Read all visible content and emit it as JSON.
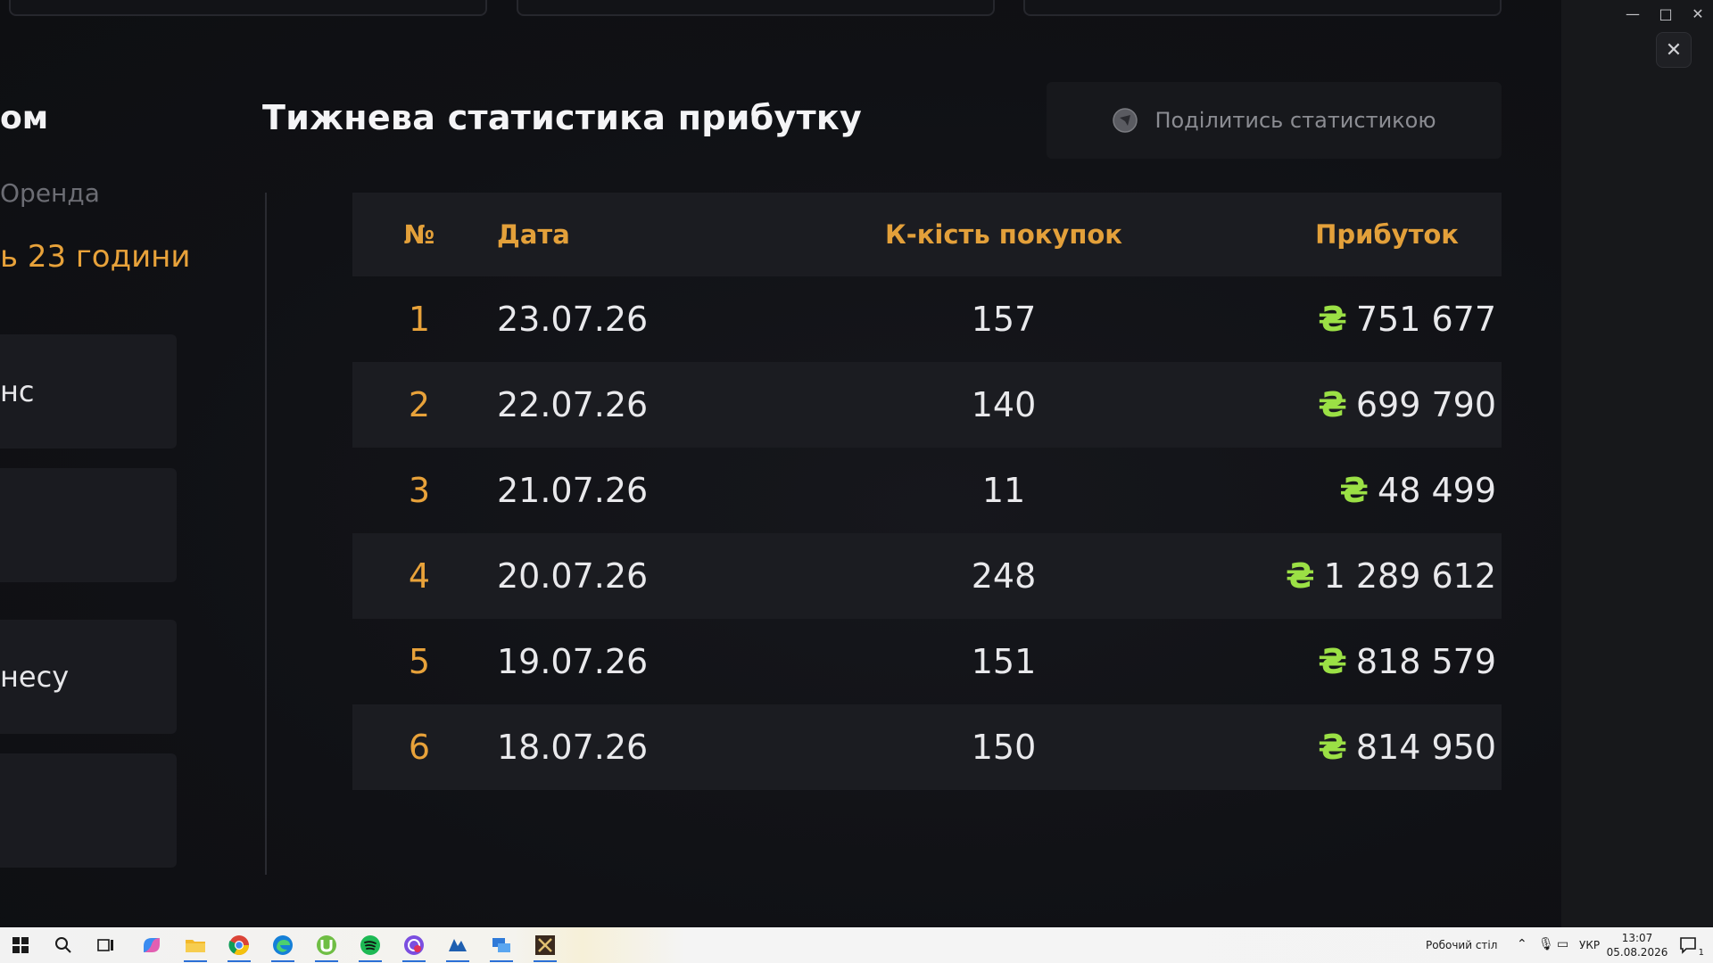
{
  "left_panel": {
    "heading": "ом",
    "sub": "Оренда",
    "time": "ь 23 години",
    "cards": [
      "нс",
      "",
      "несу",
      ""
    ]
  },
  "main": {
    "title": "Тижнева статистика прибутку",
    "share_label": "Поділитись статистикою",
    "table": {
      "headers": [
        "№",
        "Дата",
        "К-кість покупок",
        "Прибуток"
      ],
      "currency_symbol": "₴",
      "rows": [
        {
          "num": "1",
          "date": "23.07.26",
          "count": "157",
          "profit": "751 677"
        },
        {
          "num": "2",
          "date": "22.07.26",
          "count": "140",
          "profit": "699 790"
        },
        {
          "num": "3",
          "date": "21.07.26",
          "count": "11",
          "profit": "48 499"
        },
        {
          "num": "4",
          "date": "20.07.26",
          "count": "248",
          "profit": "1 289 612"
        },
        {
          "num": "5",
          "date": "19.07.26",
          "count": "151",
          "profit": "818 579"
        },
        {
          "num": "6",
          "date": "18.07.26",
          "count": "150",
          "profit": "814 950"
        }
      ]
    }
  },
  "window_controls": {
    "minimize": "—",
    "maximize": "□",
    "close": "✕"
  },
  "close_overlay": "✕",
  "taskbar": {
    "desktop_label": "Робочий стіл",
    "language": "УКР",
    "time": "13:07",
    "date": "05.08.2026",
    "notification_count": "1"
  },
  "colors": {
    "accent_orange": "#e8a23a",
    "hryvnia_green": "#9be045",
    "row_alt": "#1b1c21"
  }
}
